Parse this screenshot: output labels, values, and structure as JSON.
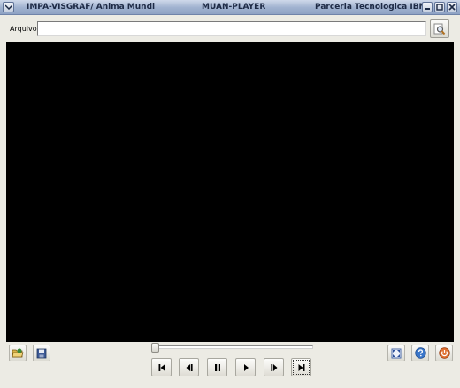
{
  "window": {
    "title_left": "IMPA-VISGRAF/ Anima Mundi",
    "title_center": "MUAN-PLAYER",
    "title_right": "Parceria Tecnologica IBM",
    "menu_icon": "chevron-down-icon",
    "buttons": [
      "minimize-icon",
      "maximize-icon",
      "close-icon"
    ]
  },
  "file": {
    "label": "Arquivo:",
    "value": "",
    "browse_icon": "search-icon"
  },
  "player": {
    "position": 0.0,
    "left_tools": [
      "open-folder-icon",
      "save-icon"
    ],
    "right_tools": [
      "fullscreen-icon",
      "help-icon",
      "power-icon"
    ],
    "transport": [
      "skip-to-start-icon",
      "step-back-icon",
      "pause-icon",
      "play-icon",
      "step-forward-icon",
      "skip-to-end-icon"
    ]
  }
}
